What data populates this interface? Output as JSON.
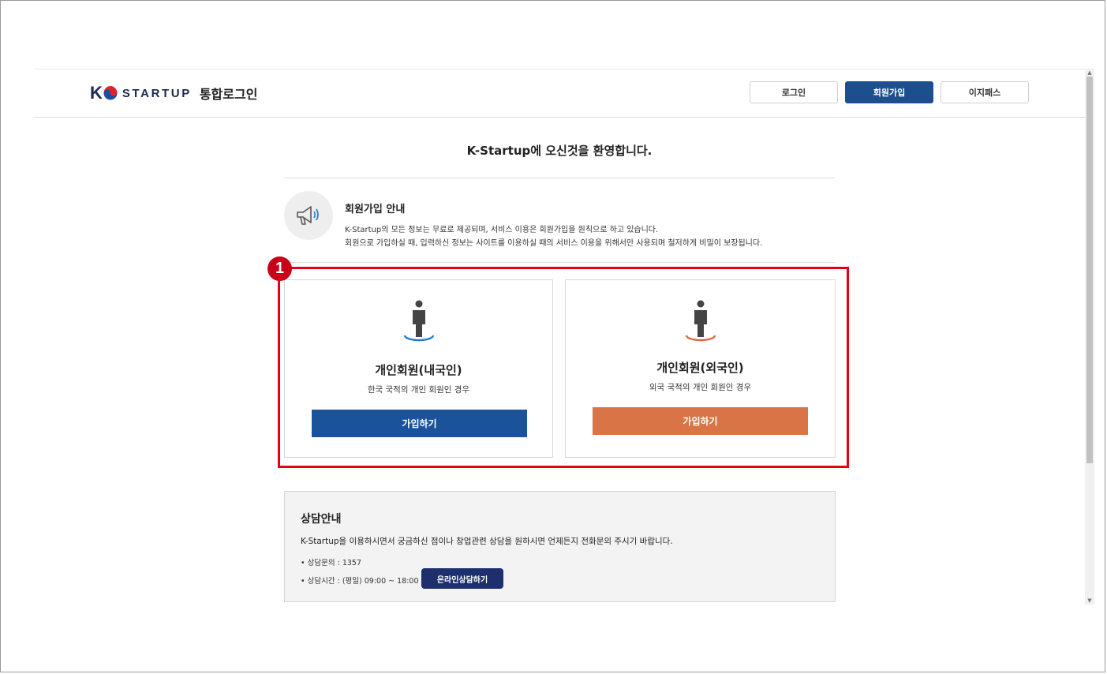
{
  "header": {
    "logo_k": "K",
    "logo_brand": "STARTUP",
    "service_name": "통합로그인",
    "buttons": {
      "login": "로그인",
      "signup": "회원가입",
      "easypass": "이지패스"
    }
  },
  "welcome": "K-Startup에 오신것을 환영합니다.",
  "notice": {
    "title": "회원가입 안내",
    "line1": "K-Startup의 모든 정보는 무료로 제공되며, 서비스 이용은 회원가입을 원칙으로 하고 있습니다.",
    "line2": "회원으로 가입하실 때, 입력하신 정보는 사이트를 이용하실 때의 서비스 이용을 위해서만 사용되며 철저하게 비밀이 보장됩니다."
  },
  "annotation_marker": "1",
  "cards": {
    "domestic": {
      "title": "개인회원(내국인)",
      "desc": "한국 국적의 개인 회원인 경우",
      "button": "가입하기"
    },
    "foreign": {
      "title": "개인회원(외국인)",
      "desc": "외국 국적의 개인 회원인 경우",
      "button": "가입하기"
    }
  },
  "consult": {
    "title": "상담안내",
    "desc": "K-Startup을 이용하시면서 궁금하신 점이나 창업관련 상담을 원하시면 언제든지 전화문의 주시기 바랍니다.",
    "phone": "• 상담문의 : 1357",
    "hours": "• 상담시간 : (평일) 09:00 ~ 18:00",
    "online_button": "온라인상담하기"
  },
  "colors": {
    "primary": "#1d4f8e",
    "domestic_button": "#1a5399",
    "foreign_button": "#d97447",
    "domestic_ring": "#1f7bd1",
    "foreign_ring": "#e0673a",
    "highlight": "#e60012",
    "consult_button": "#1d2f6d"
  },
  "icons": {
    "notice": "megaphone-icon",
    "domestic": "person-icon",
    "foreign": "person-icon"
  }
}
